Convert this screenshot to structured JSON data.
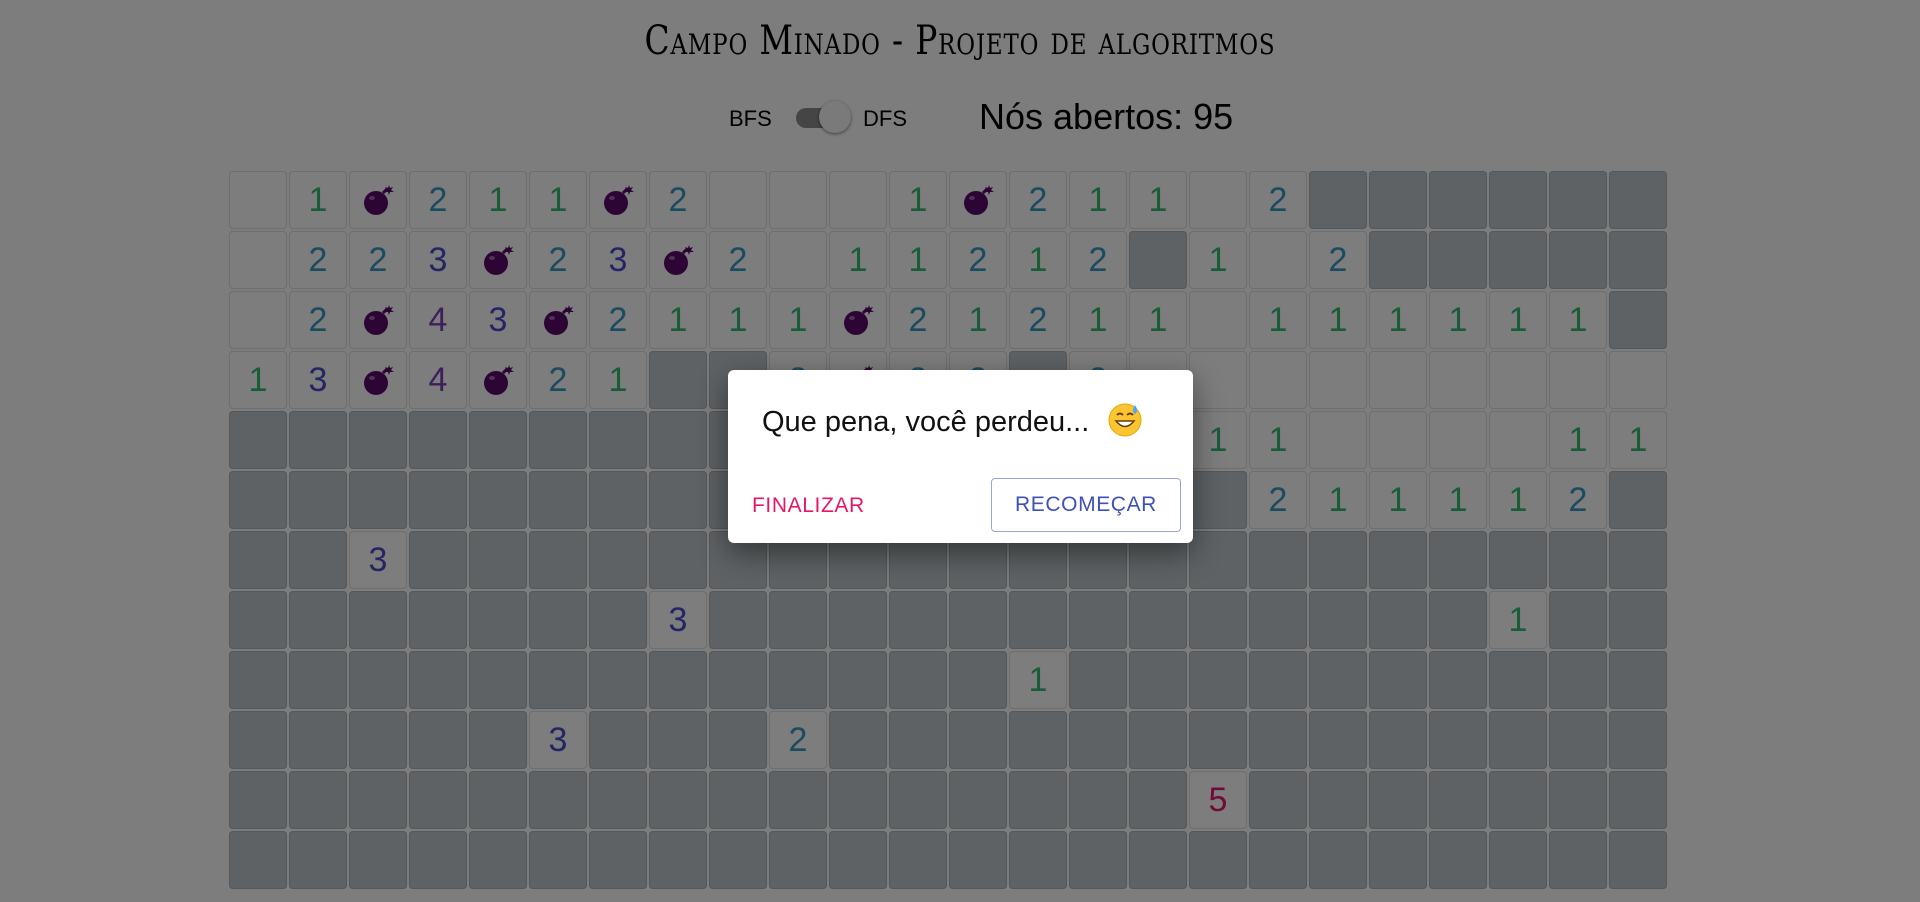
{
  "title": "Campo Minado - Projeto de algoritmos",
  "controls": {
    "bfs_label": "BFS",
    "dfs_label": "DFS",
    "toggle_value": "DFS",
    "nodes_label": "Nós abertos:",
    "nodes_count": "95"
  },
  "colors": {
    "1": "#30b870",
    "2": "#3296c3",
    "3": "#4b49c8",
    "4": "#7b3fb8",
    "5": "#e3176a",
    "bomb": "#5a0a6a",
    "overlay": "rgba(0,0,0,0.5)"
  },
  "board": {
    "legend": "H = hidden, . = empty revealed, * = bomb, digit = count",
    "rows": [
      ".1*211*2...1*211.2HHHHH",
      ".223*23*2.11212H1.2HHHHH",
      ".2*43*2111*21211.111111",
      "13*4*21HH2*22H2.........",
      "HHHHHHHHHHHHHHHH11....11",
      "HHHHHHHHHHHHHHHHH211112H",
      "HH3HHHHHHHHHHHHHHHHHHHHH",
      "HHHHHHH3HHHHHHHHHHHHH1HH",
      "HHHHHHHHHHHHH1HHHHHHHHHH",
      "HHHHH3HHH2HHHHHHHHHHHHHH",
      "HHHHHHHHHHHHHHHH5HHHHHHH",
      "HHHHHHHHHHHHHHHHHHHHHHHH"
    ]
  },
  "dialog": {
    "message": "Que pena, você perdeu...",
    "emoji_icon": "grinning-sweat-emoji",
    "finish_label": "FINALIZAR",
    "restart_label": "RECOMEÇAR"
  }
}
